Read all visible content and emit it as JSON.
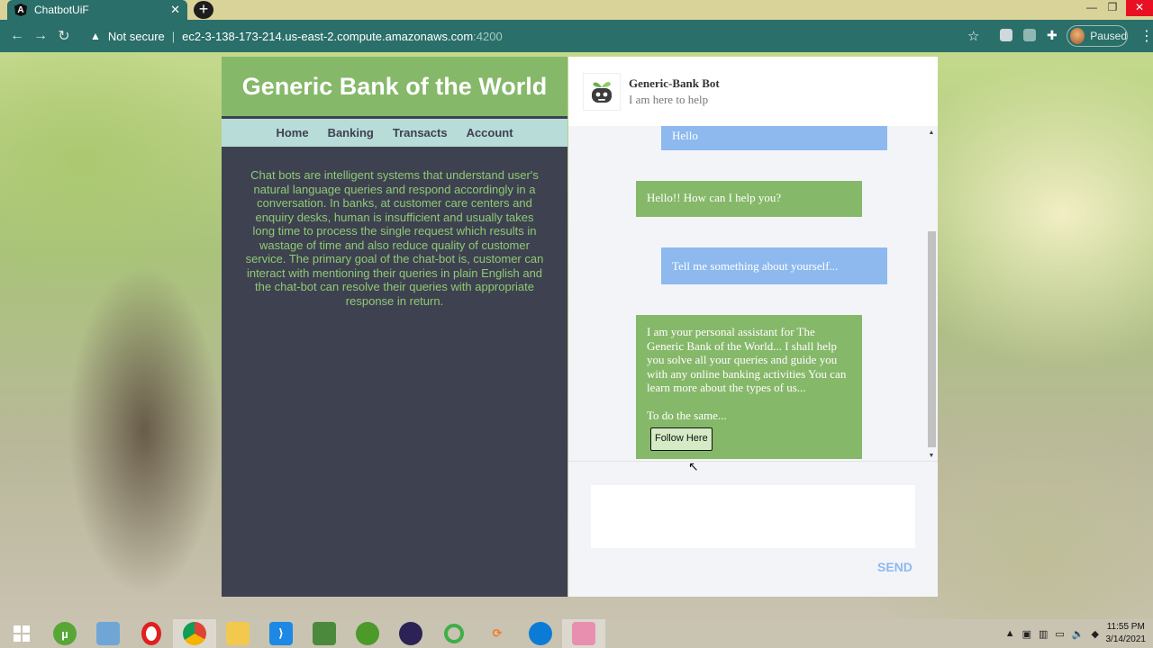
{
  "browser": {
    "tab_title": "ChatbotUiF",
    "tab_favicon_letter": "A",
    "not_secure": "Not secure",
    "url_host": "ec2-3-138-173-214.us-east-2.compute.amazonaws.com",
    "url_port": ":4200",
    "profile_status": "Paused"
  },
  "bank": {
    "title": "Generic Bank of the World",
    "nav": [
      "Home",
      "Banking",
      "Transacts",
      "Account"
    ],
    "description": "Chat bots are intelligent systems that understand user's natural language queries and respond accordingly in a conversation. In banks, at customer care centers and enquiry desks, human is insufficient and usually takes long time to process the single request which results in wastage of time and also reduce quality of customer service. The primary goal of the chat-bot is, customer can interact with mentioning their queries in plain English and the chat-bot can resolve their queries with appropriate response in return."
  },
  "chat": {
    "bot_name": "Generic-Bank Bot",
    "bot_subtitle": "I am here to help",
    "messages": [
      {
        "from": "user",
        "text": "Hello"
      },
      {
        "from": "bot",
        "text": "Hello!! How can I help you?"
      },
      {
        "from": "user",
        "text": "Tell me something about yourself..."
      },
      {
        "from": "bot",
        "text": "I am your personal assistant for The Generic Bank of the World... I shall help you solve all your queries and guide you with any online banking activities You can learn more about the types of us...",
        "text2": "To do the same...",
        "button": "Follow Here"
      }
    ],
    "input_placeholder": "",
    "send_label": "SEND"
  },
  "taskbar": {
    "time": "11:55 PM",
    "date": "3/14/2021"
  },
  "colors": {
    "bank_green": "#86b86a",
    "bank_dark": "#3e4150",
    "nav_bg": "#b8dcd8",
    "user_bubble": "#8db9ee",
    "bot_bubble": "#86b86a",
    "browser_teal": "#2a6f69"
  }
}
